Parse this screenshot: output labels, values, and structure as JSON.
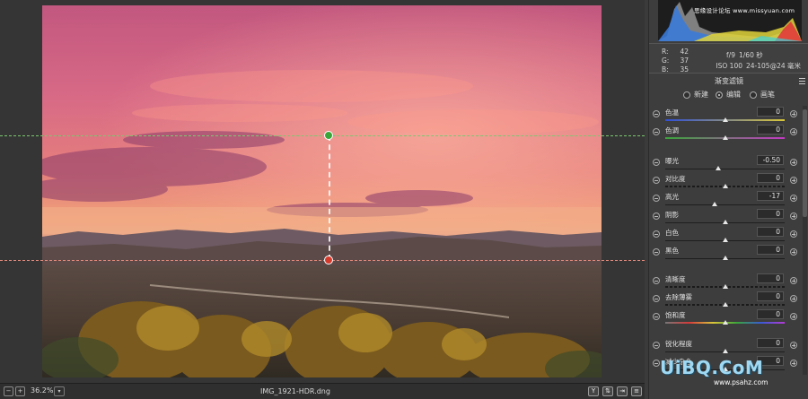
{
  "canvas": {
    "image": "mongolian-grassland-sunset-photo"
  },
  "statusbar": {
    "zoom": "36.2%",
    "filename": "IMG_1921-HDR.dng",
    "tool_y": "Y"
  },
  "histogram": {
    "watermark": "思缘设计论坛 www.missyuan.com"
  },
  "readout": {
    "r_label": "R:",
    "r_value": "42",
    "g_label": "G:",
    "g_value": "37",
    "b_label": "B:",
    "b_value": "35",
    "aperture": "f/9",
    "shutter": "1/60 秒",
    "iso": "ISO 100",
    "lens": "24-105@24 毫米"
  },
  "panel": {
    "title": "渐变滤镜",
    "modes": [
      {
        "label": "新建",
        "selected": false
      },
      {
        "label": "编辑",
        "selected": true
      },
      {
        "label": "画笔",
        "selected": false
      }
    ]
  },
  "sliders": [
    {
      "label": "色温",
      "value": "0",
      "level": 0.5,
      "track": "temp"
    },
    {
      "label": "色调",
      "value": "0",
      "level": 0.5,
      "track": "tint"
    },
    {
      "label": "曝光",
      "value": "-0.50",
      "level": 0.44,
      "track": "plain"
    },
    {
      "label": "对比度",
      "value": "0",
      "level": 0.5,
      "track": "dashed"
    },
    {
      "label": "高光",
      "value": "-17",
      "level": 0.41,
      "track": "plain"
    },
    {
      "label": "阴影",
      "value": "0",
      "level": 0.5,
      "track": "plain"
    },
    {
      "label": "白色",
      "value": "0",
      "level": 0.5,
      "track": "plain"
    },
    {
      "label": "黑色",
      "value": "0",
      "level": 0.5,
      "track": "plain"
    },
    {
      "label": "清晰度",
      "value": "0",
      "level": 0.5,
      "track": "dashed"
    },
    {
      "label": "去除薄雾",
      "value": "0",
      "level": 0.5,
      "track": "dashed"
    },
    {
      "label": "饱和度",
      "value": "0",
      "level": 0.5,
      "track": "sat"
    },
    {
      "label": "锐化程度",
      "value": "0",
      "level": 0.5,
      "track": "plain"
    },
    {
      "label": "减少杂色",
      "value": "0",
      "level": 0.5,
      "track": "plain"
    }
  ],
  "watermark": {
    "big": "UiBQ.CoM",
    "small": "www.psahz.com"
  }
}
